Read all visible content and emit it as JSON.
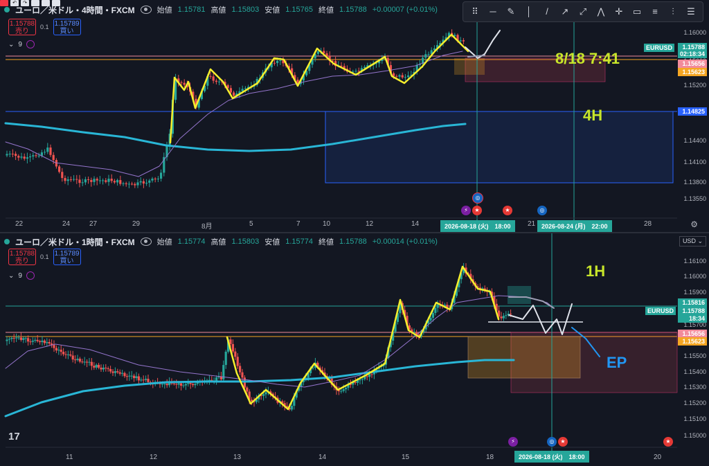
{
  "top_strip": {
    "icons": [
      "square-icon",
      "undo-icon",
      "redo-icon",
      "save-icon",
      "gear-icon",
      "copy-icon"
    ],
    "undo_glyph": "↶",
    "redo_glyph": "↷"
  },
  "toolbar": {
    "tools": [
      {
        "name": "drag-handle-icon",
        "glyph": "⠿"
      },
      {
        "name": "horizontal-line-tool-icon",
        "glyph": "─"
      },
      {
        "name": "brush-tool-icon",
        "glyph": "✎"
      },
      {
        "name": "vertical-line-tool-icon",
        "glyph": "│"
      },
      {
        "name": "trend-line-tool-icon",
        "glyph": "/"
      },
      {
        "name": "ray-tool-icon",
        "glyph": "↗"
      },
      {
        "name": "extended-line-tool-icon",
        "glyph": "⤢"
      },
      {
        "name": "path-tool-icon",
        "glyph": "⋀"
      },
      {
        "name": "crosshair-tool-icon",
        "glyph": "✛"
      },
      {
        "name": "rectangle-tool-icon",
        "glyph": "▭"
      },
      {
        "name": "fib-tool-icon",
        "glyph": "≡"
      },
      {
        "name": "settings-lines-tool-icon",
        "glyph": "⫶"
      },
      {
        "name": "more-tools-icon",
        "glyph": "☰"
      }
    ]
  },
  "top_pane": {
    "symbol": "ユーロ／米ドル・4時間・FXCM",
    "open_label": "始値",
    "open": "1.15781",
    "high_label": "高値",
    "high": "1.15803",
    "low_label": "安値",
    "low": "1.15765",
    "close_label": "終値",
    "close": "1.15788",
    "change": "+0.00007 (+0.01%)",
    "sell_price": "1.15788",
    "sell_label": "売り",
    "buy_price": "1.15789",
    "buy_label": "買い",
    "spread": "0.1",
    "indicator_count": "9",
    "annotation_time": "8/18 7:41",
    "annotation_tf": "4H",
    "y_ticks": [
      "1.16000",
      "1.15600",
      "1.15200",
      "1.14800",
      "1.14400",
      "1.14100",
      "1.13800",
      "1.13550"
    ],
    "price_tags": [
      {
        "label": "EURUSD",
        "price": "1.15788",
        "countdown": "02:18:34"
      },
      {
        "price": "1.15656"
      },
      {
        "price": "1.15623"
      },
      {
        "price": "1.14825"
      }
    ],
    "x_ticks": [
      "22",
      "24",
      "27",
      "29",
      "8月",
      "5",
      "7",
      "10",
      "12",
      "14",
      "21",
      "28"
    ],
    "time_boxes": [
      "2026-08-18 (火)　18:00",
      "2026-08-24 (月)　22:00"
    ]
  },
  "bottom_pane": {
    "symbol": "ユーロ／米ドル・1時間・FXCM",
    "open_label": "始値",
    "open": "1.15774",
    "high_label": "高値",
    "high": "1.15803",
    "low_label": "安値",
    "low": "1.15774",
    "close_label": "終値",
    "close": "1.15788",
    "change": "+0.00014 (+0.01%)",
    "sell_price": "1.15788",
    "sell_label": "売り",
    "buy_price": "1.15789",
    "buy_label": "買い",
    "spread": "0.1",
    "indicator_count": "9",
    "currency": "USD",
    "annotation_tf": "1H",
    "annotation_ep": "EP",
    "y_ticks": [
      "1.16100",
      "1.16000",
      "1.15900",
      "1.15700",
      "1.15500",
      "1.15400",
      "1.15300",
      "1.15200",
      "1.15100",
      "1.15000"
    ],
    "price_tags": [
      {
        "price": "1.15816"
      },
      {
        "label": "EURUSD",
        "price": "1.15788",
        "countdown": "18:34"
      },
      {
        "price": "1.15656"
      },
      {
        "price": "1.15623"
      }
    ],
    "x_ticks": [
      "11",
      "12",
      "13",
      "14",
      "15",
      "18",
      "20"
    ],
    "time_boxes": [
      "2026-08-18 (火)　18:00"
    ]
  },
  "colors": {
    "bg": "#131722",
    "up": "#26a69a",
    "down": "#ef5350",
    "yellow": "#f5ee2c",
    "cyan": "#29b6d6",
    "ma": "#9575cd",
    "annotation": "#c8e62a",
    "ep": "#2196f3"
  }
}
